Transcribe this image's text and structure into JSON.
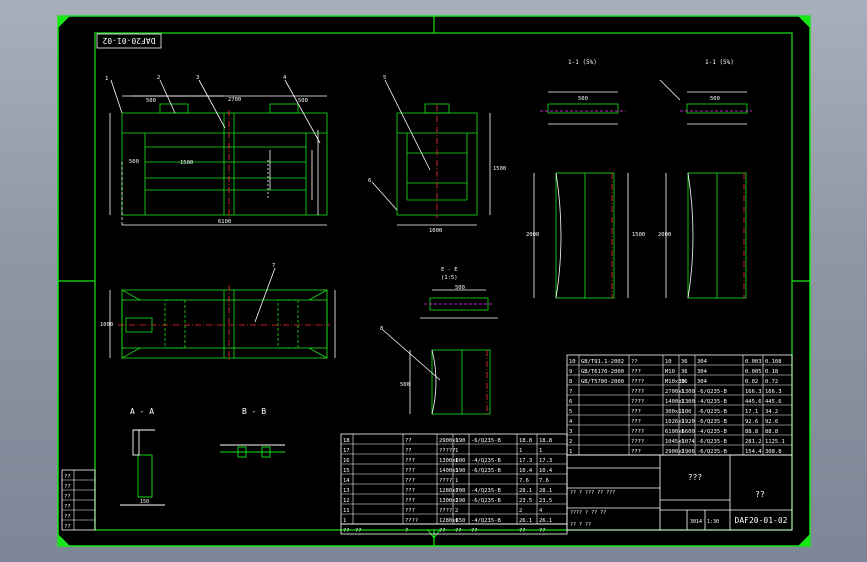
{
  "drawing_number": "DAF20-01-02",
  "drawing_number_mirrored": "DAF20-01-02",
  "title_block": {
    "name": "???",
    "material": "??",
    "scale": "1:30",
    "sheet": "3014",
    "units_row": "?? ? ??? ?? ???",
    "signature_row": "???? ? ?? ??",
    "designer_row": "?? ? ??"
  },
  "views": {
    "section_aa": "A - A",
    "section_bb": "B - B",
    "section_11_label": "1-1 (5%)",
    "section_ii_label": "1-1 (5%)",
    "view_e_label": "E - E",
    "view_e_scale": "(1:5)",
    "leader_labels": [
      "1",
      "2",
      "3",
      "4",
      "5",
      "6",
      "7",
      "8"
    ]
  },
  "dimensions": {
    "main_width": "6100",
    "main_left": "500",
    "main_mid": "2700",
    "main_right": "500",
    "main_height": "1500",
    "side_width": "1000",
    "side_height": "1500",
    "plan_width": "1000",
    "sec_a": "500",
    "sec_b": "1000",
    "sec_c": "150",
    "profile_1": "1000",
    "profile_2": "1500",
    "profile_3": "2000",
    "profile_4": "500"
  },
  "bom_upper": [
    [
      "10",
      "GB/T91.1-2002",
      "??",
      "10",
      "36",
      "304",
      "0.003",
      "0.108"
    ],
    [
      "9",
      "GB/T6170-2000",
      "???",
      "M10",
      "36",
      "304",
      "0.005",
      "0.18"
    ],
    [
      "8",
      "GB/T5780-2000",
      "????",
      "M10x30",
      "36",
      "304",
      "0.02",
      "0.72"
    ],
    [
      "7",
      "",
      "????",
      "2700x1300",
      "1",
      "-6/Q235-B",
      "166.3",
      "166.3"
    ],
    [
      "6",
      "",
      "????",
      "1400x1300",
      "1",
      "-4/Q235-B",
      "445.6",
      "445.6"
    ],
    [
      "5",
      "",
      "???",
      "300x1100",
      "1",
      "-6/Q235-B",
      "17.1",
      "34.2"
    ],
    [
      "4",
      "",
      "???",
      "1026x1920",
      "1",
      "-6/Q235-B",
      "92.6",
      "92.6"
    ],
    [
      "3",
      "",
      "????",
      "6100x6600",
      "1",
      "-4/Q235-B",
      "88.8",
      "88.8"
    ],
    [
      "2",
      "",
      "????",
      "1045x1074",
      "1",
      "-6/Q235-B",
      "281.2",
      "1125.1"
    ],
    [
      "1",
      "",
      "???",
      "2900x1906",
      "1",
      "-6/Q235-B",
      "154.4",
      "308.8"
    ]
  ],
  "bom_lower": [
    [
      "18",
      "",
      "??",
      "2900x190",
      "1",
      "-6/Q235-B",
      "18.8",
      "18.8"
    ],
    [
      "17",
      "",
      "??",
      "?????",
      "1",
      "",
      "1",
      "1"
    ],
    [
      "16",
      "",
      "???",
      "1300x600",
      "1",
      "-4/Q235-B",
      "17.3",
      "17.3"
    ],
    [
      "15",
      "",
      "???",
      "1400x190",
      "1",
      "-6/Q235-B",
      "10.4",
      "10.4"
    ],
    [
      "14",
      "",
      "???",
      "????",
      "1",
      "",
      "7.6",
      "7.6"
    ],
    [
      "13",
      "",
      "???",
      "1280x700",
      "1",
      "-4/Q235-B",
      "28.1",
      "28.1"
    ],
    [
      "12",
      "",
      "???",
      "1300x190",
      "1",
      "-6/Q235-B",
      "23.5",
      "23.5"
    ],
    [
      "11",
      "",
      "???",
      "????",
      "2",
      "",
      "2",
      "4"
    ],
    [
      "1",
      "",
      "????",
      "1280x650",
      "1",
      "-4/Q235-B",
      "26.1",
      "26.1"
    ]
  ],
  "bom_header": [
    "??",
    "??",
    "?",
    "??",
    "??",
    "??",
    "??",
    "??"
  ],
  "left_revision_cells": [
    "??",
    "??",
    "??",
    "??",
    "??",
    "??"
  ],
  "colors": {
    "background": "#000000",
    "frame": "#18e818",
    "geometry": "#ffffff",
    "dimension": "#ffffff",
    "centerline": "#ff2020",
    "hidden": "#ff00ff",
    "screen_chrome": "#8e97a5"
  }
}
